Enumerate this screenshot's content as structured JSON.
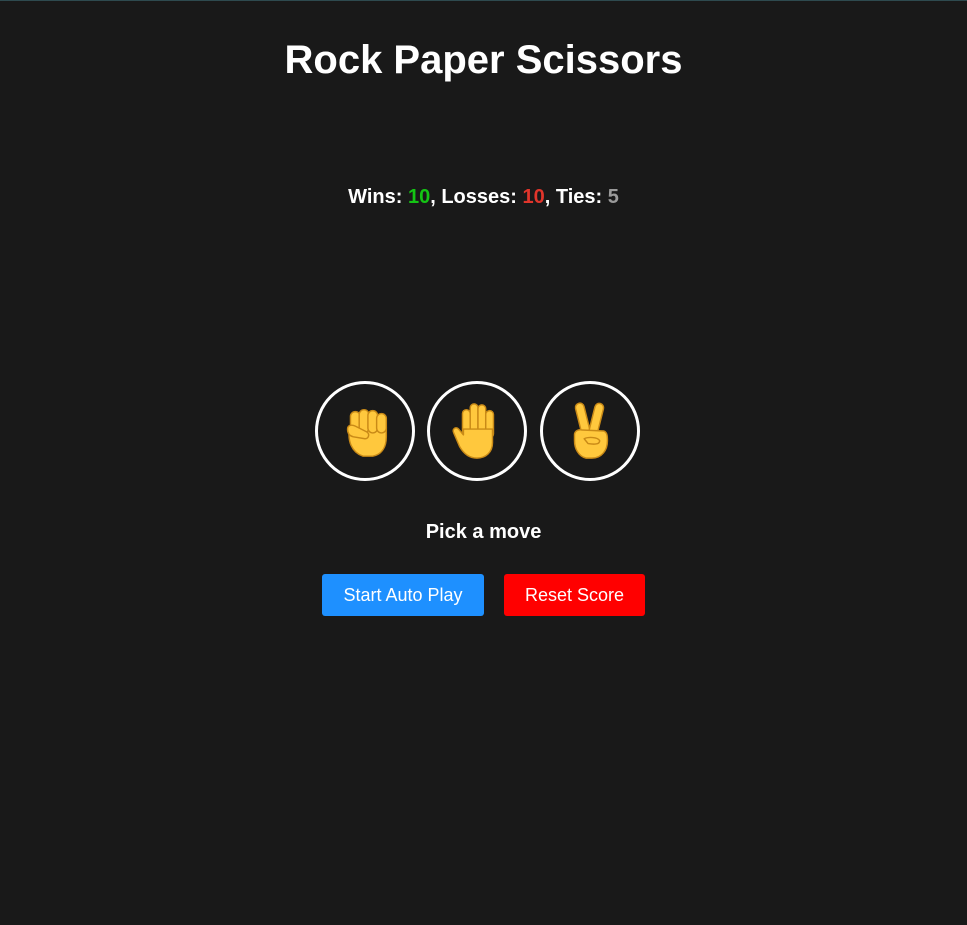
{
  "title": "Rock Paper Scissors",
  "score": {
    "wins_label": "Wins: ",
    "wins": "10",
    "losses_label": ", Losses: ",
    "losses": "10",
    "ties_label": ", Ties: ",
    "ties": "5",
    "colors": {
      "wins": "#14c414",
      "losses": "#e0352b",
      "ties": "#9a9a9a"
    }
  },
  "moves": [
    {
      "name": "rock",
      "icon": "fist-icon"
    },
    {
      "name": "paper",
      "icon": "raised-hand-icon"
    },
    {
      "name": "scissors",
      "icon": "victory-hand-icon"
    }
  ],
  "status": "Pick a move",
  "buttons": {
    "auto_play": "Start Auto Play",
    "reset": "Reset Score"
  },
  "colors": {
    "background": "#191919",
    "auto_play": "#1e90ff",
    "reset": "#ff0000",
    "emoji": "#ffc83d"
  }
}
